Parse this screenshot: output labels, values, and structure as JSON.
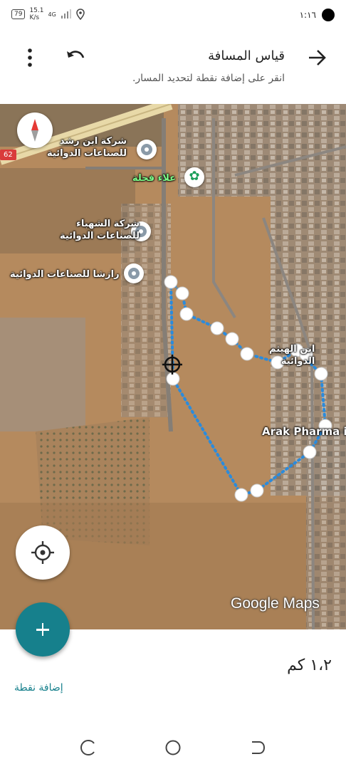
{
  "status_bar": {
    "battery": "79",
    "net_speed_value": "15.1",
    "net_speed_unit": "K/s",
    "network": "4G",
    "time": "١:١٦"
  },
  "header": {
    "title": "قياس المسافة",
    "subtitle": "انقر على إضافة نقطة لتحديد المسار.",
    "icons": [
      "arrow-back",
      "undo",
      "more-vert"
    ]
  },
  "map": {
    "route_number": "62",
    "labels": [
      {
        "line1": "شركة ابن رشد",
        "line2": "للصناعات الدوائية"
      },
      {
        "line1": "علاء فحلة",
        "line2": ""
      },
      {
        "line1": "شركة الشهباء",
        "line2": "للصناعات الدوائية"
      },
      {
        "line1": "رازشا للصناعات الدوائية",
        "line2": ""
      },
      {
        "line1": "ابن الهيثم",
        "line2": "الدوائية"
      },
      {
        "line1": "Arak Pharma i",
        "line2": ""
      }
    ],
    "attribution": "Google Maps",
    "icons": [
      "compass",
      "my-location",
      "place-pin",
      "flower-pin"
    ]
  },
  "bottom_panel": {
    "distance": "١،٢ كم",
    "add_point_label": "إضافة نقطة",
    "fab_icon": "plus",
    "accent_color": "#16808c"
  },
  "nav_bar": {
    "icons": [
      "recent-apps",
      "home",
      "back"
    ]
  }
}
